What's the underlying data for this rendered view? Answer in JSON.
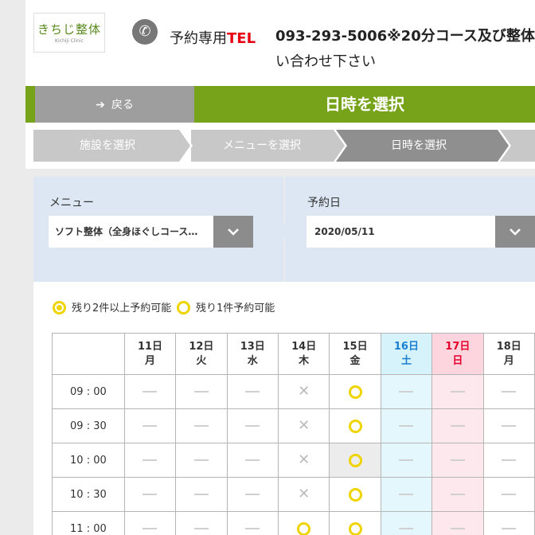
{
  "header": {
    "logo_main": "きちじ整体",
    "logo_sub": "Kichiji Clinic",
    "tel_label_prefix": "予約専用",
    "tel_label_red": "TEL",
    "tel_text_line1": "093-293-5006※20分コース及び整体",
    "tel_text_line2": "い合わせ下さい",
    "tel_icon": "phone-icon"
  },
  "nav": {
    "back_label": "戻る",
    "page_title": "日時を選択"
  },
  "steps": [
    {
      "label": "施設を選択"
    },
    {
      "label": "メニューを選択"
    },
    {
      "label": "日時を選択"
    },
    {
      "label": ""
    }
  ],
  "selectors": {
    "menu_label": "メニュー",
    "menu_value": "ソフト整体（全身ほぐしコース…",
    "date_label": "予約日",
    "date_value": "2020/05/11"
  },
  "legend": {
    "double": "残り2件以上予約可能",
    "single": "残り1件予約可能"
  },
  "colors": {
    "green": "#77a31b",
    "yellow": "#f0d400",
    "saturday": "#1a7fd0",
    "sunday": "#e4002b"
  },
  "calendar": {
    "days": [
      {
        "date": "11日",
        "dow": "月",
        "type": "weekday"
      },
      {
        "date": "12日",
        "dow": "火",
        "type": "weekday"
      },
      {
        "date": "13日",
        "dow": "水",
        "type": "weekday"
      },
      {
        "date": "14日",
        "dow": "木",
        "type": "weekday"
      },
      {
        "date": "15日",
        "dow": "金",
        "type": "weekday"
      },
      {
        "date": "16日",
        "dow": "土",
        "type": "sat"
      },
      {
        "date": "17日",
        "dow": "日",
        "type": "sun"
      },
      {
        "date": "18日",
        "dow": "月",
        "type": "weekday"
      }
    ],
    "rows": [
      {
        "time": "09 : 00",
        "slots": [
          "dash",
          "dash",
          "dash",
          "cross",
          "circle",
          "dash",
          "dash",
          "dash"
        ]
      },
      {
        "time": "09 : 30",
        "slots": [
          "dash",
          "dash",
          "dash",
          "cross",
          "circle",
          "dash",
          "dash",
          "dash"
        ]
      },
      {
        "time": "10 : 00",
        "slots": [
          "dash",
          "dash",
          "dash",
          "cross",
          "circle-hl",
          "dash",
          "dash",
          "dash"
        ]
      },
      {
        "time": "10 : 30",
        "slots": [
          "dash",
          "dash",
          "dash",
          "cross",
          "circle",
          "dash",
          "dash",
          "dash"
        ]
      },
      {
        "time": "11 : 00",
        "slots": [
          "dash",
          "dash",
          "dash",
          "circle",
          "circle",
          "dash",
          "dash",
          "dash"
        ]
      }
    ]
  }
}
